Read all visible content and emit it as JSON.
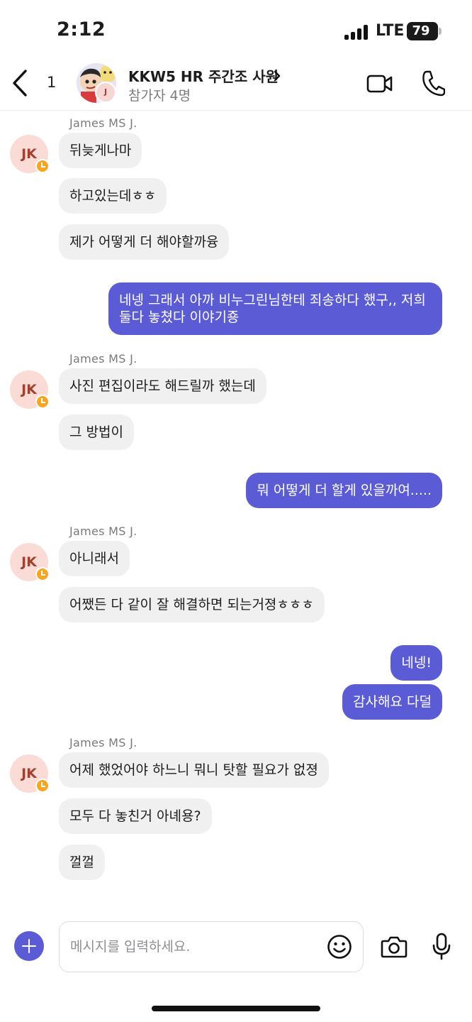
{
  "status_bar": {
    "time": "2:12",
    "network": "LTE",
    "battery": 79
  },
  "header": {
    "unread_count": "1",
    "title": "KKW5 HR 주간조 사원",
    "subtitle": "참가자 4명",
    "avatar_initial": "J",
    "icons": {
      "back": "chevron-left-icon",
      "title": "chevron-right-icon",
      "video": "video-camera-icon",
      "call": "phone-icon"
    }
  },
  "messages": {
    "groups": [
      {
        "type": "incoming",
        "sender": "James MS J.",
        "avatar_initials": "JK",
        "bubbles": [
          "뒤늦게나마",
          "하고있는데ㅎㅎ",
          "제가 어떻게 더 해야할까융"
        ]
      },
      {
        "type": "outgoing",
        "bubbles": [
          "네넹 그래서 아까 비누그린님한테 죄송하다 했구,, 저희 둘다 놓쳤다 이야기죵"
        ]
      },
      {
        "type": "incoming",
        "sender": "James MS J.",
        "avatar_initials": "JK",
        "bubbles": [
          "사진 편집이라도 해드릴까 했는데",
          "그 방법이"
        ]
      },
      {
        "type": "outgoing",
        "bubbles": [
          "뭐 어떻게 더 할게 있을까여....."
        ]
      },
      {
        "type": "incoming",
        "sender": "James MS J.",
        "avatar_initials": "JK",
        "bubbles": [
          "아니래서",
          "어쨌든 다 같이 잘 해결하면 되는거졍ㅎㅎㅎ"
        ]
      },
      {
        "type": "outgoing",
        "bubbles": [
          "네넹!",
          "감사해요 다덜"
        ]
      },
      {
        "type": "incoming",
        "sender": "James MS J.",
        "avatar_initials": "JK",
        "bubbles": [
          "어제 했었어야 하느니 뭐니 탓할 필요가 없졍",
          "모두 다 놓친거 아녜용?",
          "껄껄"
        ]
      }
    ]
  },
  "composer": {
    "placeholder": "메시지를 입력하세요.",
    "value": "",
    "icons": {
      "add": "plus-icon",
      "emoji": "smiley-icon",
      "camera": "camera-icon",
      "mic": "microphone-icon"
    }
  },
  "colors": {
    "accent": "#5b5bd6",
    "incoming_bubble": "#f0f0f1",
    "avatar_bg": "#fadbd5",
    "avatar_text": "#a3412e",
    "badge": "#f5a623"
  }
}
